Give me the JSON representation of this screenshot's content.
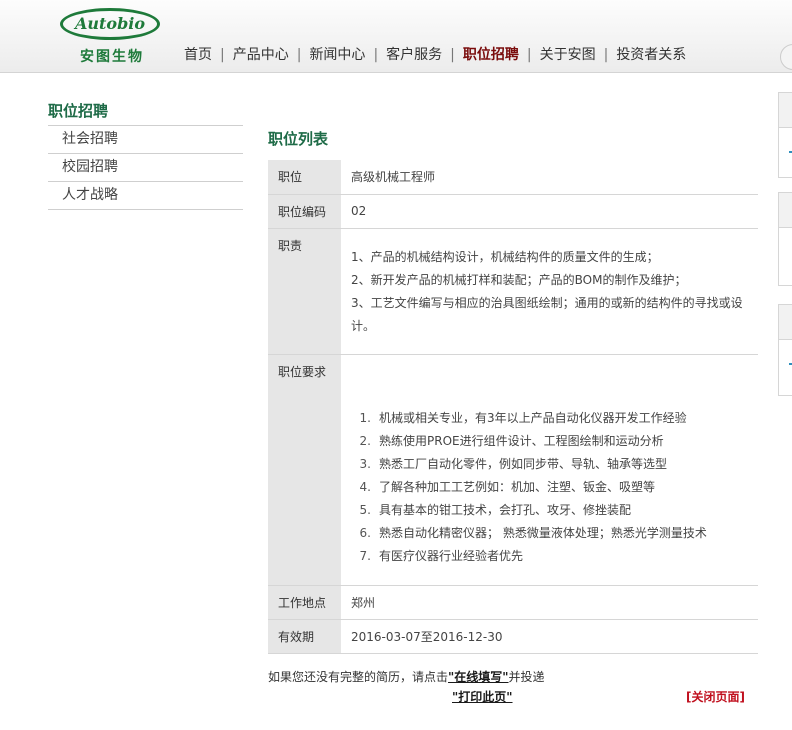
{
  "header": {
    "logo_text": "Autobio",
    "logo_cn": "安图生物",
    "nav": [
      "首页",
      "产品中心",
      "新闻中心",
      "客户服务",
      "职位招聘",
      "关于安图",
      "投资者关系"
    ],
    "nav_active": "职位招聘",
    "nav_separator": "|"
  },
  "sidebar": {
    "title": "职位招聘",
    "items": [
      "社会招聘",
      "校园招聘",
      "人才战略"
    ]
  },
  "main": {
    "title": "职位列表",
    "rows": {
      "position": {
        "label": "职位",
        "value": "高级机械工程师"
      },
      "code": {
        "label": "职位编码",
        "value": "02"
      },
      "duties": {
        "label": "职责",
        "lines": [
          "1、产品的机械结构设计，机械结构件的质量文件的生成；",
          "2、新开发产品的机械打样和装配；产品的BOM的制作及维护；",
          "3、工艺文件编写与相应的治具图纸绘制；通用的或新的结构件的寻找或设",
          "计。"
        ]
      },
      "requirements": {
        "label": "职位要求",
        "items": [
          {
            "num": "1.",
            "text": "机械或相关专业，有3年以上产品自动化仪器开发工作经验"
          },
          {
            "num": "2.",
            "text": "熟练使用PROE进行组件设计、工程图绘制和运动分析"
          },
          {
            "num": "3.",
            "text": "熟悉工厂自动化零件，例如同步带、导轨、轴承等选型"
          },
          {
            "num": "4.",
            "text": "了解各种加工工艺例如：机加、注塑、钣金、吸塑等"
          },
          {
            "num": "5.",
            "text": "具有基本的钳工技术，会打孔、攻牙、修挫装配"
          },
          {
            "num": "6.",
            "text": "熟悉自动化精密仪器；  熟悉微量液体处理；熟悉光学测量技术"
          },
          {
            "num": "7.",
            "text": "有医疗仪器行业经验者优先"
          }
        ]
      },
      "location": {
        "label": "工作地点",
        "value": "郑州"
      },
      "validity": {
        "label": "有效期",
        "value": "2016-03-07至2016-12-30"
      }
    }
  },
  "footer": {
    "resume_prefix": "如果您还没有完整的简历，请点击",
    "resume_link": "\"在线填写\"",
    "resume_suffix": "并投递",
    "print_link": "\"打印此页\"",
    "close_link": "[关闭页面]"
  },
  "colors": {
    "brand_green": "#1e7a3a",
    "active_nav": "#7a0c0c",
    "close_red": "#c0101e",
    "label_bg": "#e6e6e6"
  }
}
